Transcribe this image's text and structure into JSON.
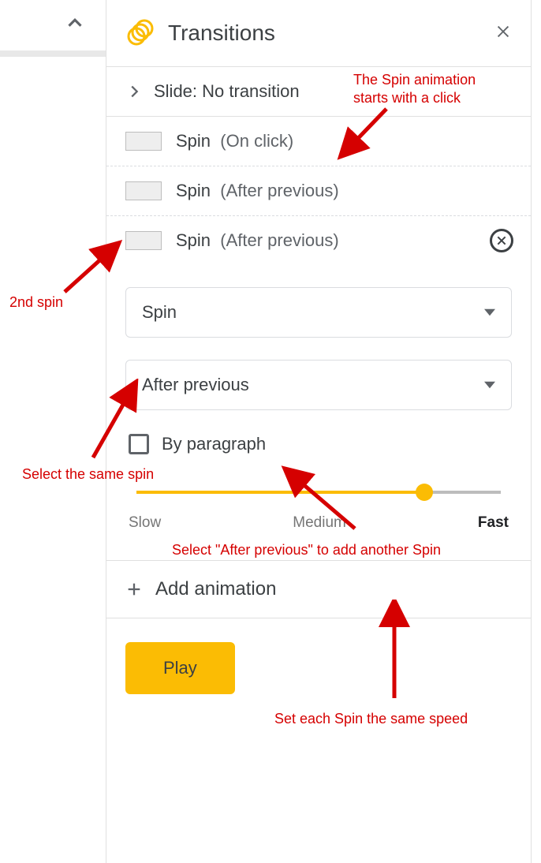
{
  "header": {
    "title": "Transitions"
  },
  "slide_row": {
    "label": "Slide: No transition"
  },
  "animations": [
    {
      "name": "Spin",
      "trigger": "(On click)"
    },
    {
      "name": "Spin",
      "trigger": "(After previous)"
    },
    {
      "name": "Spin",
      "trigger": "(After previous)"
    }
  ],
  "detail": {
    "type_select": "Spin",
    "start_select": "After previous",
    "by_paragraph_label": "By paragraph",
    "by_paragraph_checked": false,
    "speed": {
      "slow": "Slow",
      "medium": "Medium",
      "fast": "Fast",
      "value_pct": 79
    }
  },
  "add_animation_label": "Add animation",
  "play_label": "Play",
  "annotations": {
    "a1": "The Spin animation\nstarts with a click",
    "a2": "2nd spin",
    "a3": "Select the same spin",
    "a4": "Select \"After previous\" to add another Spin",
    "a5": "Set each Spin the same speed"
  }
}
